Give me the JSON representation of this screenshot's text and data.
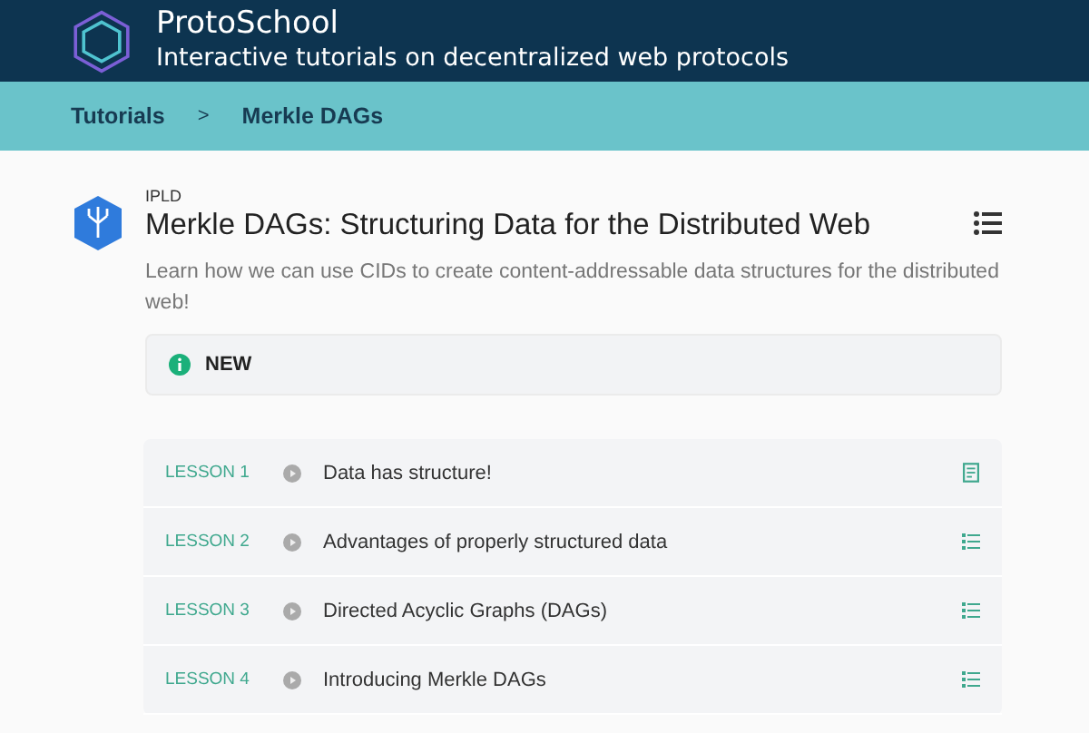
{
  "header": {
    "title": "ProtoSchool",
    "subtitle": "Interactive tutorials on decentralized web protocols"
  },
  "breadcrumb": [
    "Tutorials",
    ">",
    "Merkle DAGs"
  ],
  "tutorial": {
    "category": "IPLD",
    "title": "Merkle DAGs: Structuring Data for the Distributed Web",
    "description": "Learn how we can use CIDs to create content-addressable data structures for the distributed web!",
    "badge": "NEW"
  },
  "lessons": [
    {
      "number": "LESSON 1",
      "title": "Data has structure!",
      "kind": "document"
    },
    {
      "number": "LESSON 2",
      "title": "Advantages of properly structured data",
      "kind": "list"
    },
    {
      "number": "LESSON 3",
      "title": "Directed Acyclic Graphs (DAGs)",
      "kind": "list"
    },
    {
      "number": "LESSON 4",
      "title": "Introducing Merkle DAGs",
      "kind": "list"
    }
  ]
}
